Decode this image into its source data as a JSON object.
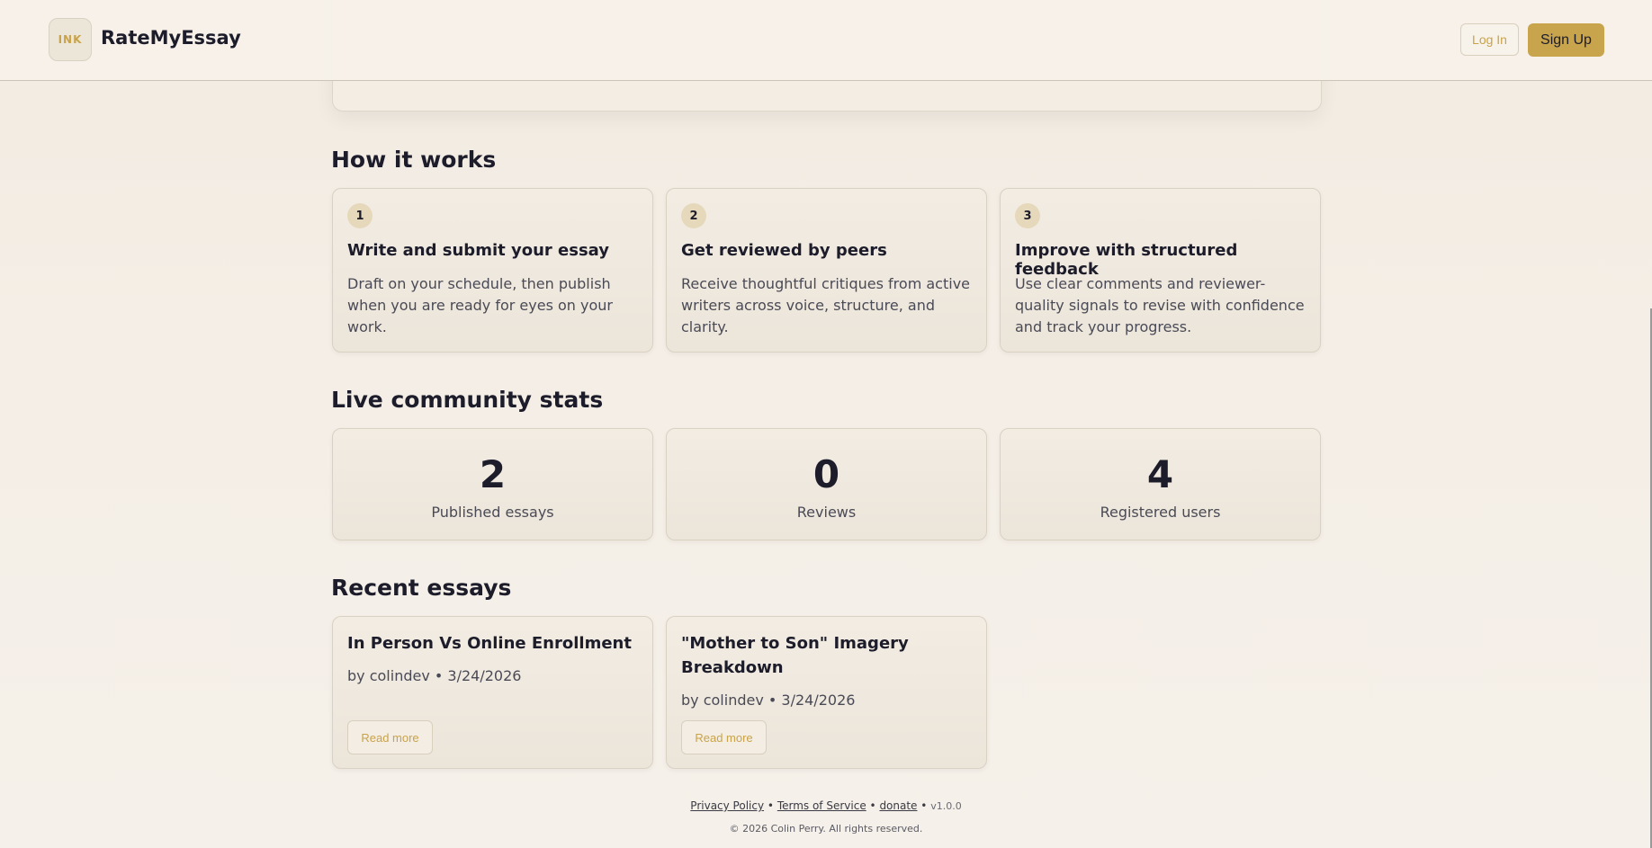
{
  "header": {
    "logo_text": "INK",
    "brand": "RateMyEssay",
    "login_label": "Log In",
    "signup_label": "Sign Up"
  },
  "how_it_works": {
    "title": "How it works",
    "steps": [
      {
        "num": "1",
        "title": "Write and submit your essay",
        "desc": "Draft on your schedule, then publish when you are ready for eyes on your work."
      },
      {
        "num": "2",
        "title": "Get reviewed by peers",
        "desc": "Receive thoughtful critiques from active writers across voice, structure, and clarity."
      },
      {
        "num": "3",
        "title": "Improve with structured feedback",
        "desc": "Use clear comments and reviewer-quality signals to revise with confidence and track your progress."
      }
    ]
  },
  "stats": {
    "title": "Live community stats",
    "items": [
      {
        "value": "2",
        "label": "Published essays"
      },
      {
        "value": "0",
        "label": "Reviews"
      },
      {
        "value": "4",
        "label": "Registered users"
      }
    ]
  },
  "recent": {
    "title": "Recent essays",
    "essays": [
      {
        "title": "In Person Vs Online Enrollment",
        "meta": "by colindev • 3/24/2026",
        "action": "Read more"
      },
      {
        "title": "\"Mother to Son\" Imagery Breakdown",
        "meta": "by colindev • 3/24/2026",
        "action": "Read more"
      }
    ]
  },
  "footer": {
    "privacy": "Privacy Policy",
    "terms": "Terms of Service",
    "donate": "donate",
    "sep": "•",
    "version": "v1.0.0",
    "copyright": "© 2026 Colin Perry. All rights reserved."
  },
  "colors": {
    "accent": "#c8a44d",
    "background": "#f4eee6",
    "text": "#1c1c2a"
  }
}
